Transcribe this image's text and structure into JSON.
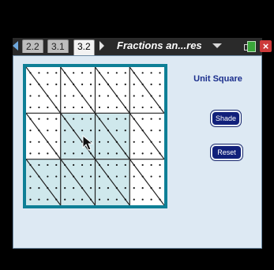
{
  "tabs": [
    {
      "label": "2.2",
      "active": false
    },
    {
      "label": "3.1",
      "active": false
    },
    {
      "label": "3.2",
      "active": true
    }
  ],
  "document_title": "Fractions an...res",
  "panel": {
    "title": "Unit Square",
    "shade_label": "Shade",
    "reset_label": "Reset"
  },
  "grid": {
    "rows": 3,
    "cols": 4,
    "dots_per_cell_row": 4,
    "shaded_region": "lower-left L-shaped area (rows 2-3, cols 1-3)"
  },
  "colors": {
    "frame": "#0e7f96",
    "shade": "#cfe8ec",
    "button_bg": "#11207a",
    "title": "#1a2e8c",
    "close": "#cc3a3a",
    "battery": "#3aa63a"
  },
  "icons": {
    "left_tab_arrow": "left-arrow-icon",
    "right_tab_arrow": "right-arrow-icon",
    "title_dropdown": "chevron-down-icon",
    "battery": "battery-icon",
    "close": "close-icon",
    "cursor": "mouse-pointer-icon"
  }
}
